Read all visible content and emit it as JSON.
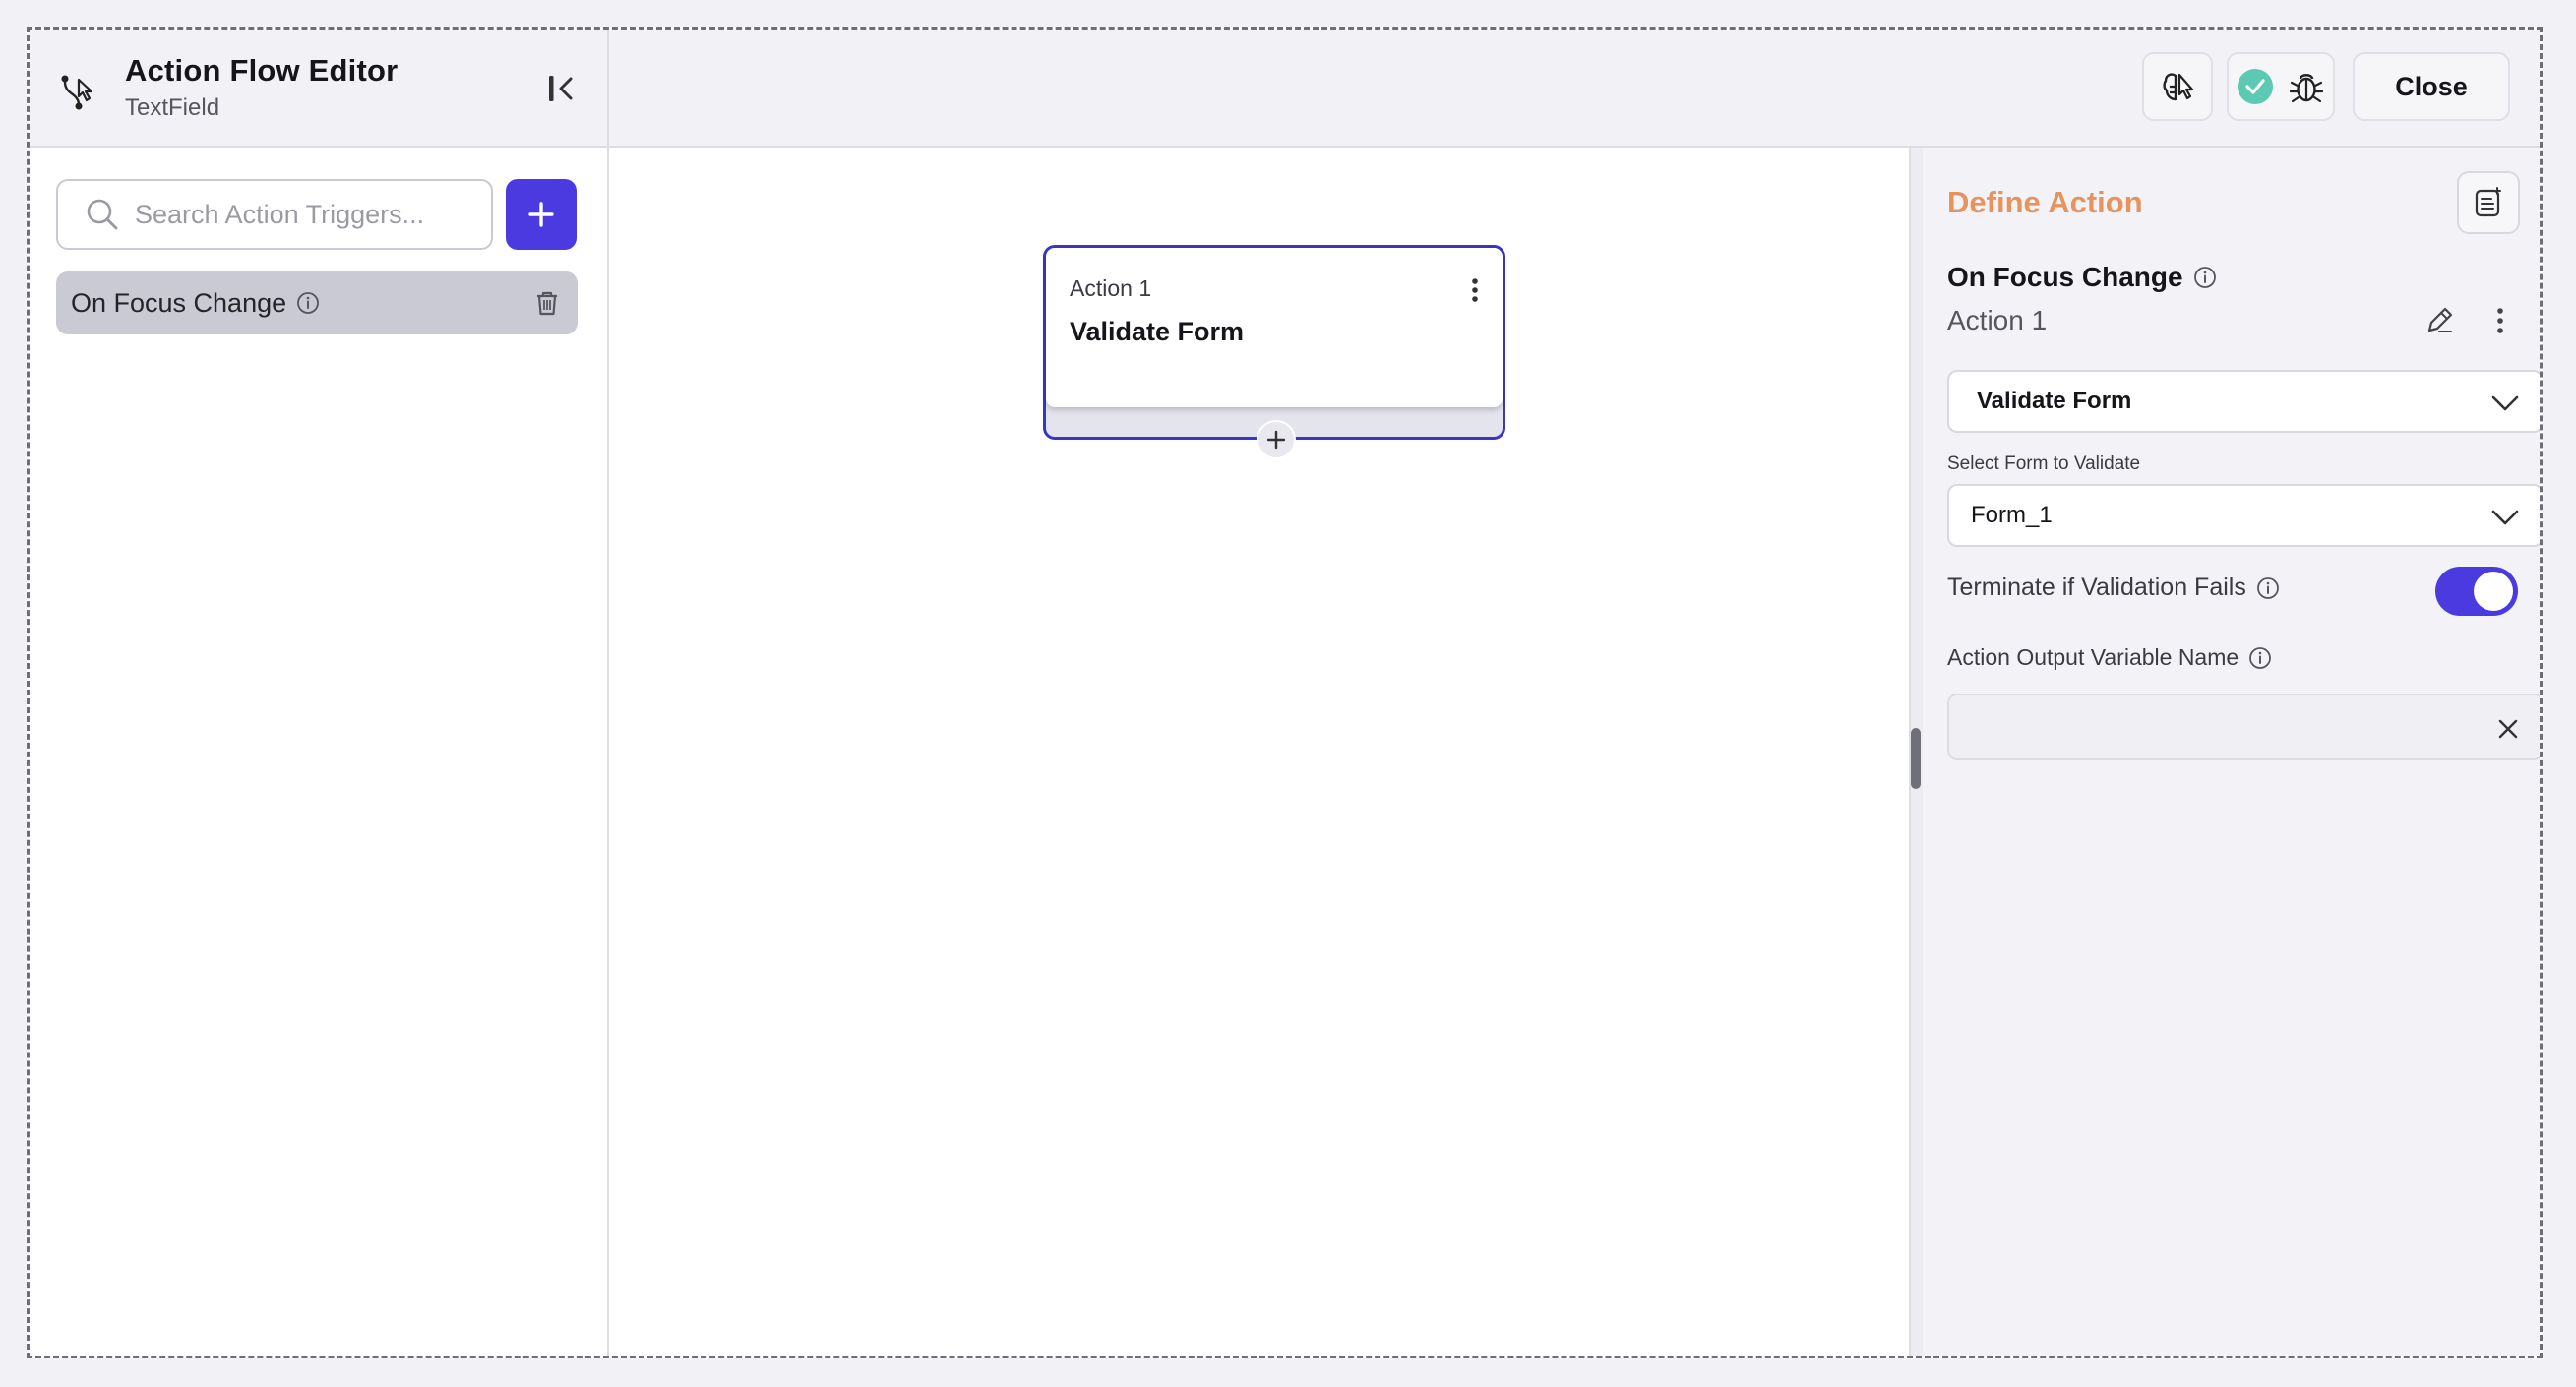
{
  "header": {
    "title": "Action Flow Editor",
    "subtitle": "TextField",
    "close_label": "Close"
  },
  "sidebar": {
    "search_placeholder": "Search Action Triggers...",
    "triggers": [
      {
        "label": "On Focus Change"
      }
    ]
  },
  "canvas": {
    "node": {
      "label": "Action 1",
      "title": "Validate Form"
    }
  },
  "panel": {
    "header": "Define Action",
    "trigger": "On Focus Change",
    "action_name": "Action 1",
    "action_type": "Validate Form",
    "form_label": "Select Form to Validate",
    "form_value": "Form_1",
    "terminate_label": "Terminate if Validation Fails",
    "terminate_enabled": true,
    "output_label": "Action Output Variable Name",
    "output_value": ""
  },
  "colors": {
    "accent": "#4a3ae0",
    "header_orange": "#e6935d",
    "status_green": "#5ccab2"
  }
}
